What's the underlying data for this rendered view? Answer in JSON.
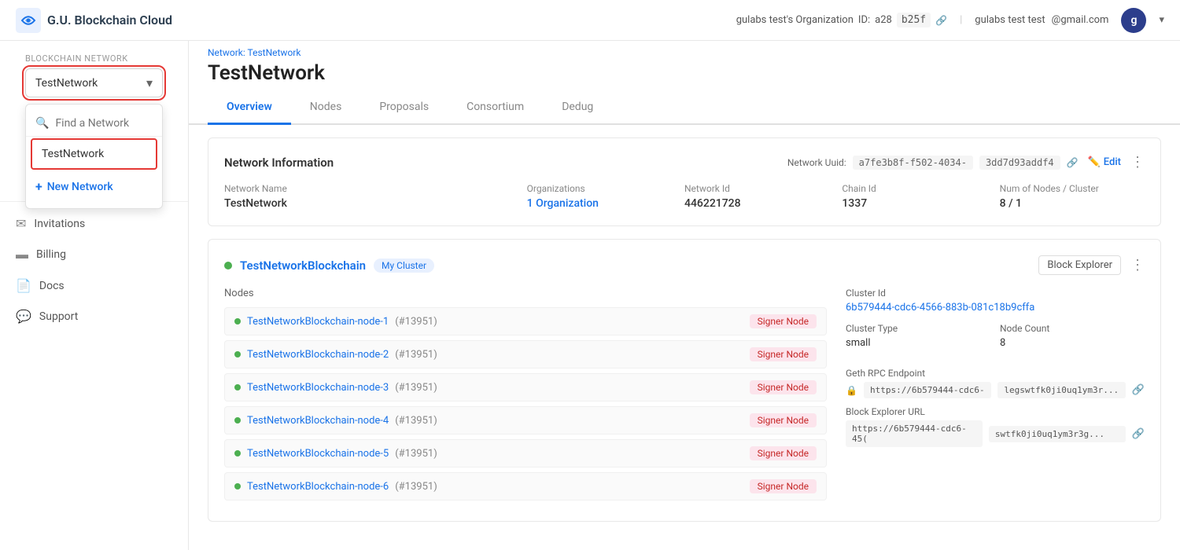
{
  "app": {
    "name": "G.U. Blockchain Cloud",
    "logo_alt": "GU Blockchain Logo"
  },
  "header": {
    "org_label": "gulabs test's Organization",
    "org_id_label": "ID:",
    "org_id": "a28",
    "org_id_suffix": "b25f",
    "user_name": "gulabs test  test",
    "user_email": "@gmail.com",
    "avatar_letter": "g"
  },
  "sidebar": {
    "section_label": "Blockchain Network",
    "selected_network": "TestNetwork",
    "dropdown_placeholder": "Find a Network",
    "dropdown_item": "TestNetwork",
    "new_network_label": "New Network",
    "nav_items": [
      {
        "label": "Invitations",
        "icon": "✉"
      },
      {
        "label": "Billing",
        "icon": "💳"
      },
      {
        "label": "Docs",
        "icon": "📄"
      },
      {
        "label": "Support",
        "icon": "💬"
      }
    ]
  },
  "breadcrumb": {
    "prefix": "Network:",
    "network": "TestNetwork"
  },
  "page": {
    "title": "TestNetwork"
  },
  "tabs": [
    {
      "label": "Overview",
      "active": true
    },
    {
      "label": "Nodes",
      "active": false
    },
    {
      "label": "Proposals",
      "active": false
    },
    {
      "label": "Consortium",
      "active": false
    },
    {
      "label": "Dedug",
      "active": false
    }
  ],
  "network_info": {
    "card_title": "Network Information",
    "uuid_label": "Network Uuid:",
    "uuid_val1": "a7fe3b8f-f502-4034-",
    "uuid_val2": "3dd7d93addf4",
    "edit_label": "Edit",
    "fields": {
      "network_name_label": "Network Name",
      "network_name_val": "TestNetwork",
      "orgs_label": "Organizations",
      "orgs_val": "1 Organization",
      "network_id_label": "Network Id",
      "network_id_val": "446221728",
      "chain_id_label": "Chain Id",
      "chain_id_val": "1337",
      "nodes_label": "Num of Nodes / Cluster",
      "nodes_val": "8 / 1"
    }
  },
  "cluster": {
    "name": "TestNetworkBlockchain",
    "badge": "My Cluster",
    "block_explorer_btn": "Block Explorer",
    "nodes_label": "Nodes",
    "cluster_id_label": "Cluster Id",
    "cluster_id_val": "6b579444-cdc6-4566-883b-081c18b9cffa",
    "cluster_type_label": "Cluster Type",
    "cluster_type_val": "small",
    "node_count_label": "Node Count",
    "node_count_val": "8",
    "geth_rpc_label": "Geth RPC Endpoint",
    "geth_rpc_icon": "🔒",
    "geth_rpc_val": "https://6b579444-cdc6-",
    "geth_rpc_suffix": "legswtfk0ji0uq1ym3r...",
    "block_explorer_url_label": "Block Explorer URL",
    "block_explorer_url_val": "https://6b579444-cdc6-45(",
    "block_explorer_url_suffix": "swtfk0ji0uq1ym3r3g...",
    "nodes": [
      {
        "name": "TestNetworkBlockchain-node-1",
        "id": "(#13951)",
        "badge": "Signer Node"
      },
      {
        "name": "TestNetworkBlockchain-node-2",
        "id": "(#13951)",
        "badge": "Signer Node"
      },
      {
        "name": "TestNetworkBlockchain-node-3",
        "id": "(#13951)",
        "badge": "Signer Node"
      },
      {
        "name": "TestNetworkBlockchain-node-4",
        "id": "(#13951)",
        "badge": "Signer Node"
      },
      {
        "name": "TestNetworkBlockchain-node-5",
        "id": "(#13951)",
        "badge": "Signer Node"
      },
      {
        "name": "TestNetworkBlockchain-node-6",
        "id": "(#13951)",
        "badge": "Signer Node"
      }
    ]
  }
}
